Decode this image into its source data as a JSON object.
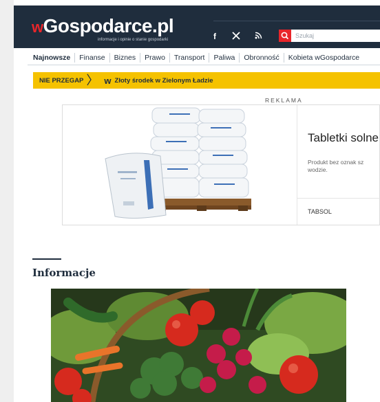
{
  "header": {
    "logo_prefix": "w",
    "logo_main": "Gospodarce.pl",
    "tagline": "informacje i opinie o stanie gospodarki",
    "social_icons": [
      "facebook-icon",
      "x-icon",
      "rss-icon"
    ],
    "search_placeholder": "Szukaj"
  },
  "nav": {
    "items": [
      {
        "label": "Najnowsze"
      },
      {
        "label": "Finanse"
      },
      {
        "label": "Biznes"
      },
      {
        "label": "Prawo"
      },
      {
        "label": "Transport"
      },
      {
        "label": "Paliwa"
      },
      {
        "label": "Obronność"
      },
      {
        "label": "Kobieta wGospodarce"
      }
    ]
  },
  "breaking": {
    "label": "NIE PRZEGAP",
    "logo": "w",
    "text": "Złoty środek w Zielonym Ładzie"
  },
  "ad": {
    "label": "REKLAMA",
    "title": "Tabletki solne",
    "description": "Produkt bez oznak sz wodzie.",
    "brand": "TABSOL"
  },
  "section": {
    "title": "Informacje"
  },
  "colors": {
    "header_bg": "#1f2d3d",
    "accent_red": "#e8252a",
    "breaking_yellow": "#f5c200"
  }
}
